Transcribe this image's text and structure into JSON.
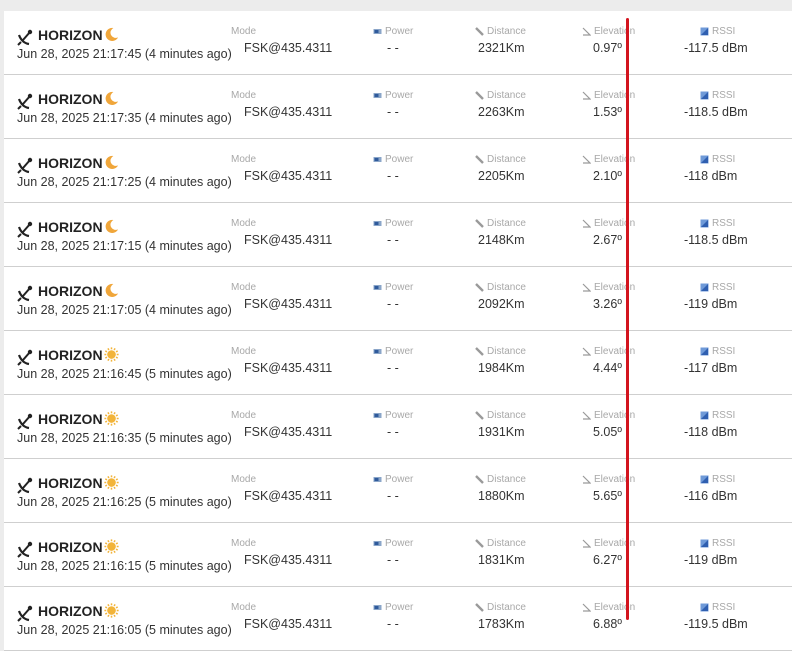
{
  "labels": {
    "mode": "Mode",
    "power": "Power",
    "distance": "Distance",
    "elevation": "Elevation",
    "rssi": "RSSI"
  },
  "colors": {
    "background": "#ececec",
    "row": "#ffffff",
    "divider": "#cfcfcf",
    "marker_line": "#d3141e",
    "moon": "#f0a63a",
    "sun": "#f2b43a"
  },
  "icons": {
    "satellite": "satellite-icon",
    "night": "crescent-moon-icon",
    "day": "sun-icon",
    "power": "power-meter-icon",
    "distance": "ruler-icon",
    "elevation": "angle-icon",
    "rssi": "signal-icon"
  },
  "packets": [
    {
      "satellite": "HORIZON",
      "time_of_day": "night",
      "timestamp": "Jun 28, 2025 21:17:45 (4 minutes ago)",
      "mode": "FSK@435.4311",
      "power": "- -",
      "distance": "2321Km",
      "elevation": "0.97º",
      "rssi": "-117.5 dBm"
    },
    {
      "satellite": "HORIZON",
      "time_of_day": "night",
      "timestamp": "Jun 28, 2025 21:17:35 (4 minutes ago)",
      "mode": "FSK@435.4311",
      "power": "- -",
      "distance": "2263Km",
      "elevation": "1.53º",
      "rssi": "-118.5 dBm"
    },
    {
      "satellite": "HORIZON",
      "time_of_day": "night",
      "timestamp": "Jun 28, 2025 21:17:25 (4 minutes ago)",
      "mode": "FSK@435.4311",
      "power": "- -",
      "distance": "2205Km",
      "elevation": "2.10º",
      "rssi": "-118 dBm"
    },
    {
      "satellite": "HORIZON",
      "time_of_day": "night",
      "timestamp": "Jun 28, 2025 21:17:15 (4 minutes ago)",
      "mode": "FSK@435.4311",
      "power": "- -",
      "distance": "2148Km",
      "elevation": "2.67º",
      "rssi": "-118.5 dBm"
    },
    {
      "satellite": "HORIZON",
      "time_of_day": "night",
      "timestamp": "Jun 28, 2025 21:17:05 (4 minutes ago)",
      "mode": "FSK@435.4311",
      "power": "- -",
      "distance": "2092Km",
      "elevation": "3.26º",
      "rssi": "-119 dBm"
    },
    {
      "satellite": "HORIZON",
      "time_of_day": "day",
      "timestamp": "Jun 28, 2025 21:16:45 (5 minutes ago)",
      "mode": "FSK@435.4311",
      "power": "- -",
      "distance": "1984Km",
      "elevation": "4.44º",
      "rssi": "-117 dBm"
    },
    {
      "satellite": "HORIZON",
      "time_of_day": "day",
      "timestamp": "Jun 28, 2025 21:16:35 (5 minutes ago)",
      "mode": "FSK@435.4311",
      "power": "- -",
      "distance": "1931Km",
      "elevation": "5.05º",
      "rssi": "-118 dBm"
    },
    {
      "satellite": "HORIZON",
      "time_of_day": "day",
      "timestamp": "Jun 28, 2025 21:16:25 (5 minutes ago)",
      "mode": "FSK@435.4311",
      "power": "- -",
      "distance": "1880Km",
      "elevation": "5.65º",
      "rssi": "-116 dBm"
    },
    {
      "satellite": "HORIZON",
      "time_of_day": "day",
      "timestamp": "Jun 28, 2025 21:16:15 (5 minutes ago)",
      "mode": "FSK@435.4311",
      "power": "- -",
      "distance": "1831Km",
      "elevation": "6.27º",
      "rssi": "-119 dBm"
    },
    {
      "satellite": "HORIZON",
      "time_of_day": "day",
      "timestamp": "Jun 28, 2025 21:16:05 (5 minutes ago)",
      "mode": "FSK@435.4311",
      "power": "- -",
      "distance": "1783Km",
      "elevation": "6.88º",
      "rssi": "-119.5 dBm"
    }
  ]
}
